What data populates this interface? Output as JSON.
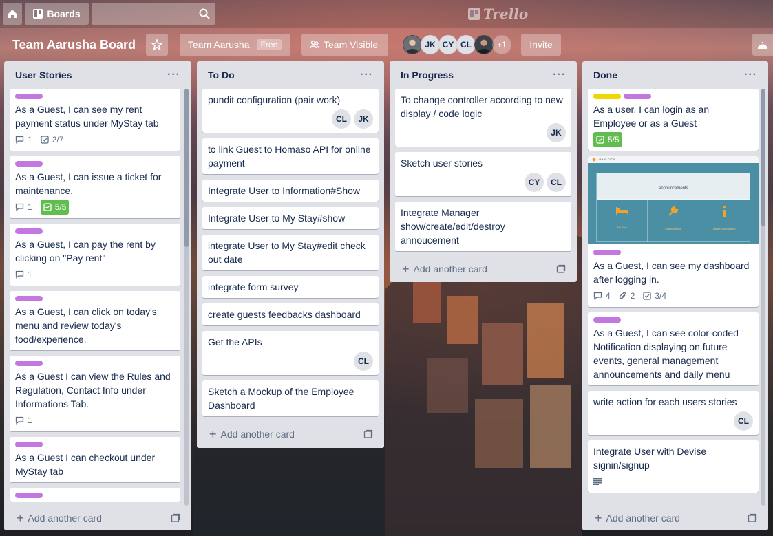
{
  "app": {
    "boards_label": "Boards",
    "search_placeholder": "",
    "logo_text": "Trello"
  },
  "board": {
    "title": "Team Aarusha Board",
    "team_label": "Team Aarusha",
    "team_badge": "Free",
    "visibility_label": "Team Visible",
    "invite_label": "Invite",
    "members": [
      "JK",
      "CY",
      "CL"
    ],
    "more_members": "+1"
  },
  "lists": [
    {
      "title": "User Stories",
      "add_label": "Add another card",
      "cards": [
        {
          "text": "As a Guest, I can see my rent payment status under MyStay tab",
          "comments": "1",
          "checklist": "2/7"
        },
        {
          "text": "As a Guest, I can issue a ticket for maintenance.",
          "comments": "1",
          "checklist": "5/5"
        },
        {
          "text": "As a Guest, I can pay the rent by clicking on \"Pay rent\"",
          "comments": "1"
        },
        {
          "text": "As a Guest, I can click on today's menu and review today's food/experience."
        },
        {
          "text": "As a Guest I can view the Rules and Regulation, Contact Info under Informations Tab.",
          "comments": "1"
        },
        {
          "text": "As a Guest I can checkout under MyStay tab"
        }
      ]
    },
    {
      "title": "To Do",
      "add_label": "Add another card",
      "cards": [
        {
          "text": "pundit configuration (pair work)",
          "members": [
            "CL",
            "JK"
          ]
        },
        {
          "text": "to link Guest to Homaso API for online payment"
        },
        {
          "text": "Integrate User to Information#Show"
        },
        {
          "text": "Integrate User to My Stay#show"
        },
        {
          "text": "integrate User to My Stay#edit check out date"
        },
        {
          "text": "integrate form survey"
        },
        {
          "text": "create guests feedbacks dashboard"
        },
        {
          "text": "Get the APIs",
          "members": [
            "CL"
          ]
        },
        {
          "text": "Sketch a Mockup of the Employee Dashboard"
        }
      ]
    },
    {
      "title": "In Progress",
      "add_label": "Add another card",
      "cards": [
        {
          "text": "To change controller according to new display / code logic",
          "members": [
            "JK"
          ]
        },
        {
          "text": "Sketch user stories",
          "members": [
            "CY",
            "CL"
          ]
        },
        {
          "text": "Integrate Manager show/create/edit/destroy annoucement"
        }
      ]
    },
    {
      "title": "Done",
      "add_label": "Add another card",
      "cards": [
        {
          "text": "As a user, I can login as an Employee or as a Guest",
          "checklist": "5/5"
        },
        {
          "text": "As a Guest, I can see my dashboard after logging in.",
          "comments": "4",
          "attachments": "2",
          "checklist": "3/4",
          "cover": {
            "brand": "AARUSHA",
            "heading": "Announcements",
            "tiles": [
              "My Stay",
              "Maintenance",
              "Hostel Information"
            ]
          }
        },
        {
          "text": "As a Guest, I can see color-coded Notification displaying on future events, general management announcements and daily menu"
        },
        {
          "text": "write action for each users stories",
          "members": [
            "CL"
          ]
        },
        {
          "text": "Integrate User with Devise signin/signup"
        }
      ]
    }
  ],
  "colors": {
    "label_purple": "#c377e0",
    "label_yellow": "#f2d600",
    "complete_green": "#61bd4f",
    "list_bg": "#dfe1e6"
  }
}
